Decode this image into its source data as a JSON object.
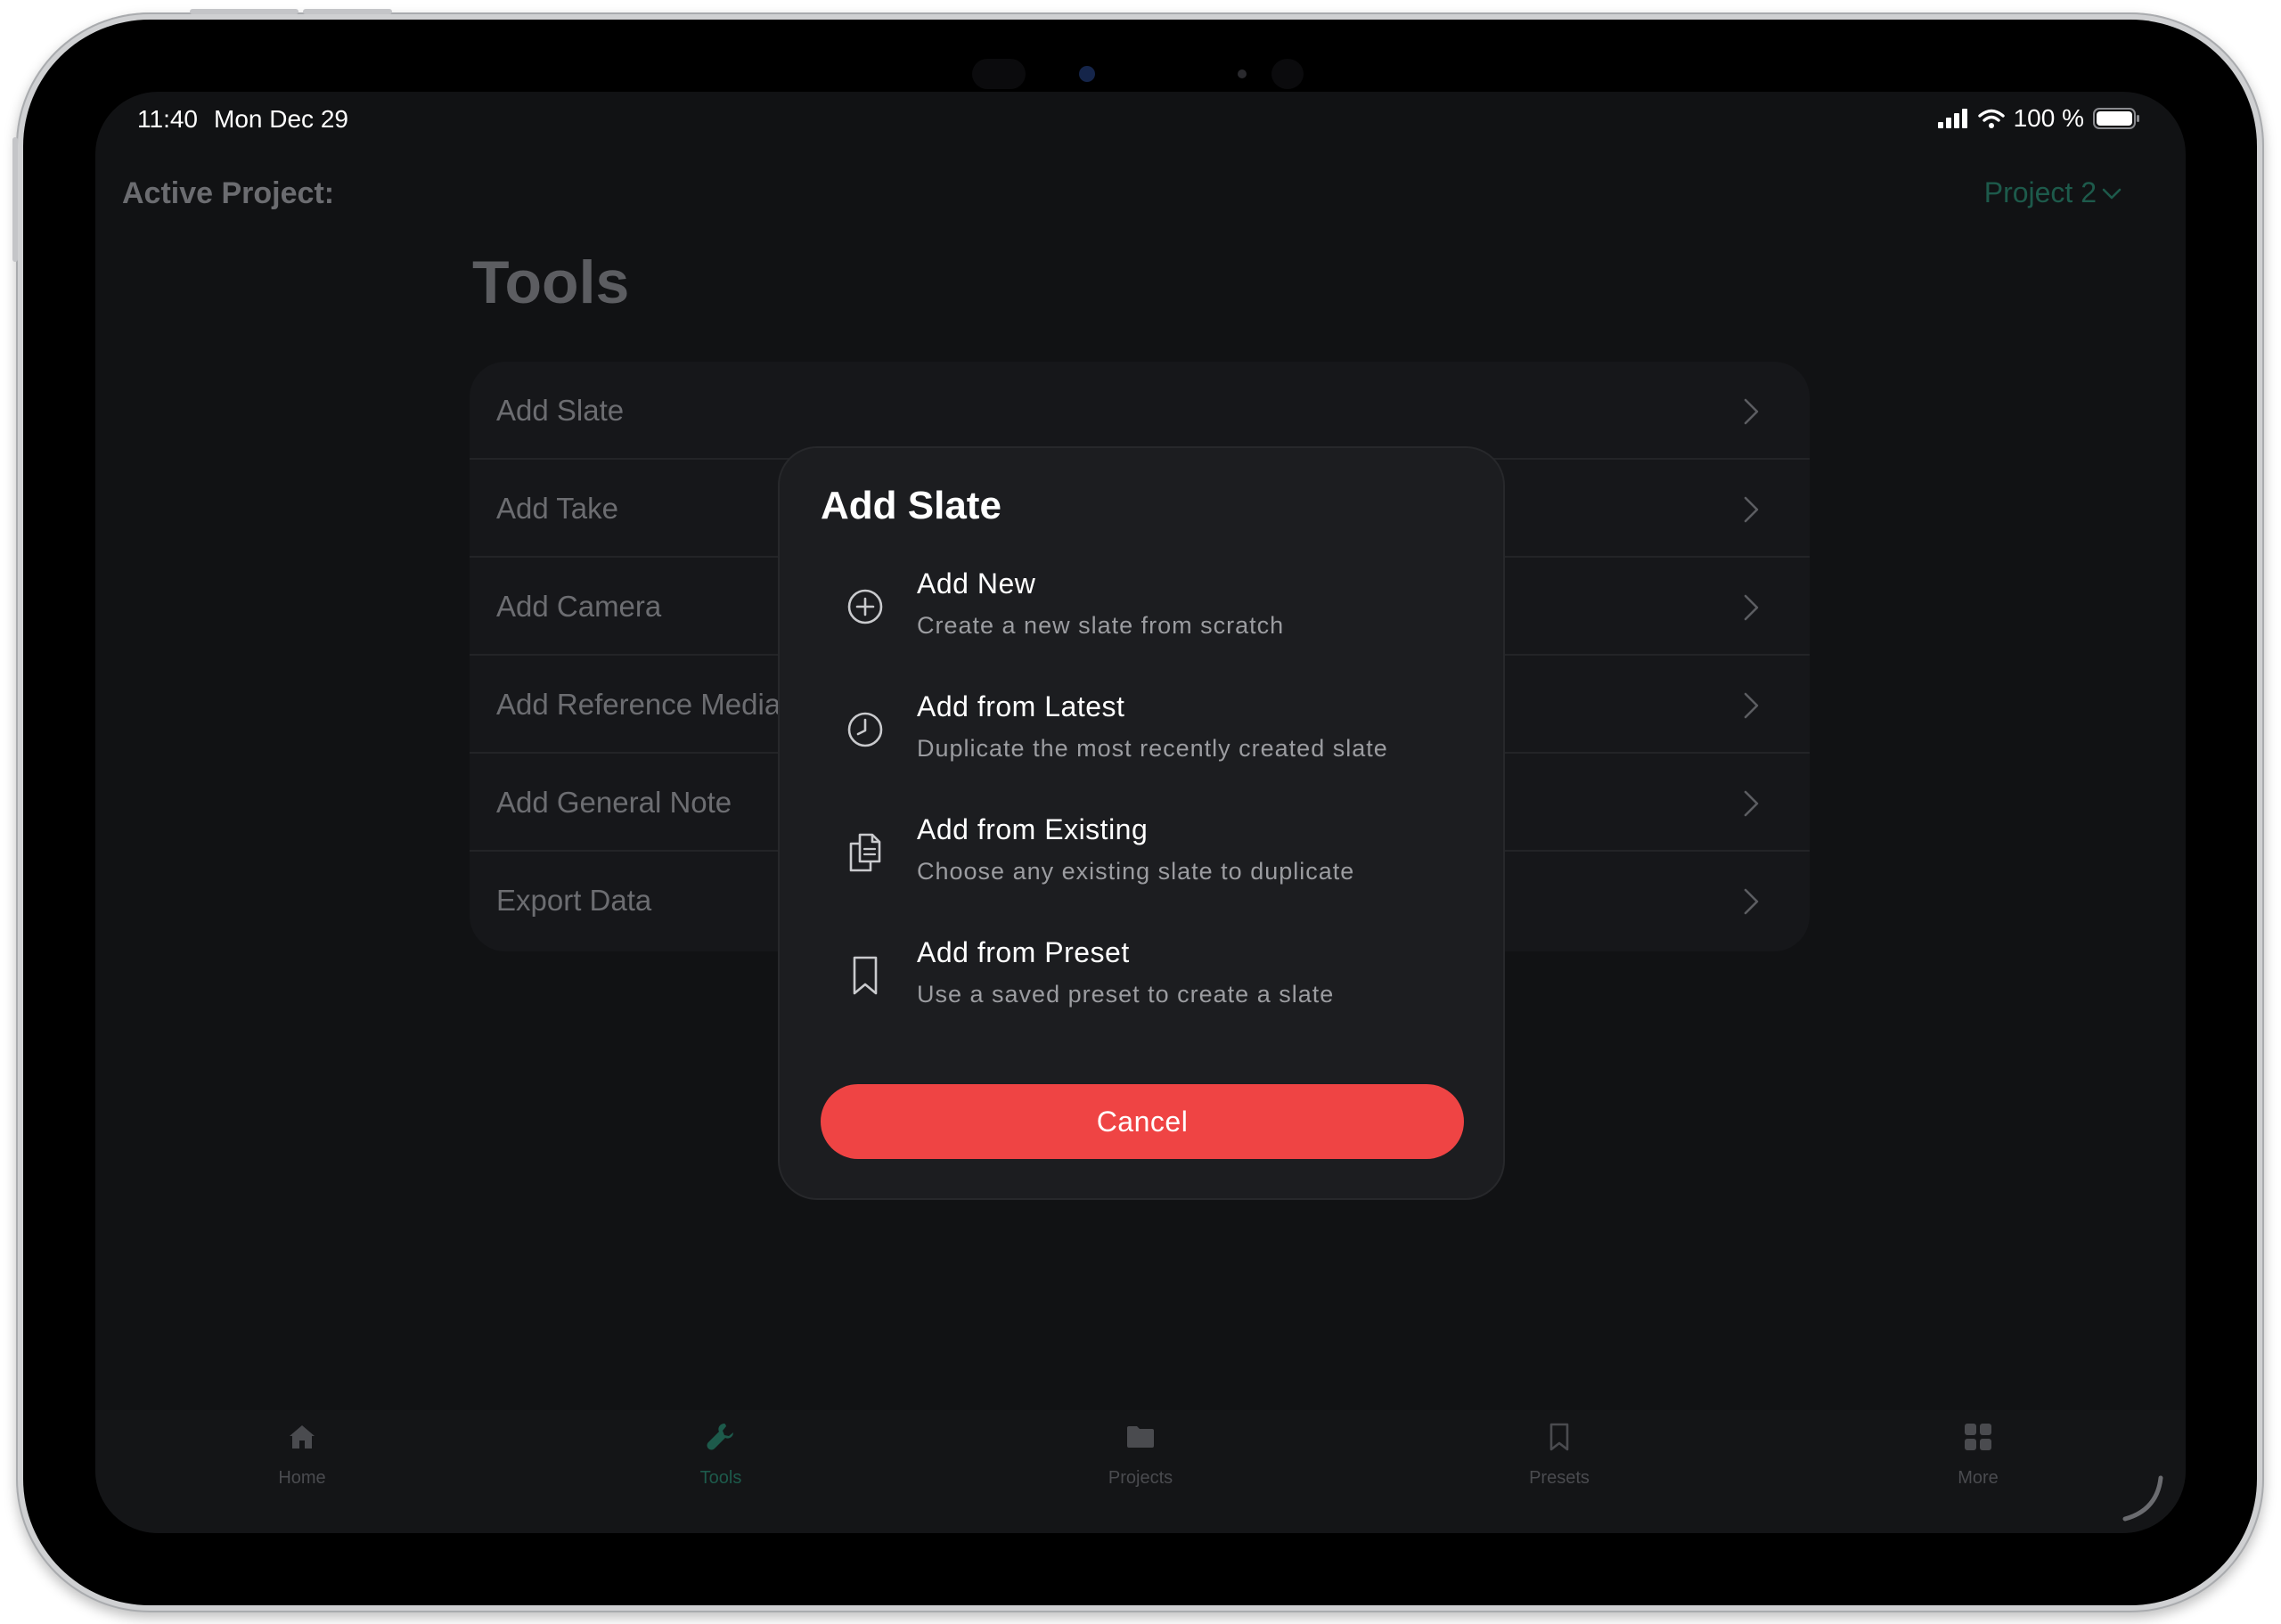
{
  "status_bar": {
    "time": "11:40",
    "date": "Mon Dec 29",
    "battery": "100 %"
  },
  "header": {
    "active_project_label": "Active Project:",
    "project_name": "Project 2"
  },
  "page": {
    "title": "Tools"
  },
  "tools_list": [
    {
      "label": "Add Slate"
    },
    {
      "label": "Add Take"
    },
    {
      "label": "Add Camera"
    },
    {
      "label": "Add Reference Media"
    },
    {
      "label": "Add General Note"
    },
    {
      "label": "Export Data"
    }
  ],
  "modal": {
    "title": "Add Slate",
    "options": [
      {
        "title": "Add New",
        "subtitle": "Create a new slate from scratch",
        "icon": "plus-circle-icon"
      },
      {
        "title": "Add from Latest",
        "subtitle": "Duplicate the most recently created slate",
        "icon": "clock-icon"
      },
      {
        "title": "Add from Existing",
        "subtitle": "Choose any existing slate to duplicate",
        "icon": "documents-icon"
      },
      {
        "title": "Add from Preset",
        "subtitle": "Use a saved preset to create a slate",
        "icon": "bookmark-icon"
      }
    ],
    "cancel_label": "Cancel"
  },
  "tab_bar": [
    {
      "label": "Home",
      "icon": "home-icon"
    },
    {
      "label": "Tools",
      "icon": "wrench-icon",
      "active": true
    },
    {
      "label": "Projects",
      "icon": "folder-icon"
    },
    {
      "label": "Presets",
      "icon": "bookmark-icon"
    },
    {
      "label": "More",
      "icon": "grid-icon"
    }
  ],
  "colors": {
    "accent": "#1d5a4b",
    "danger": "#ef4444",
    "background": "#111214",
    "modal_background": "#1c1d20"
  }
}
